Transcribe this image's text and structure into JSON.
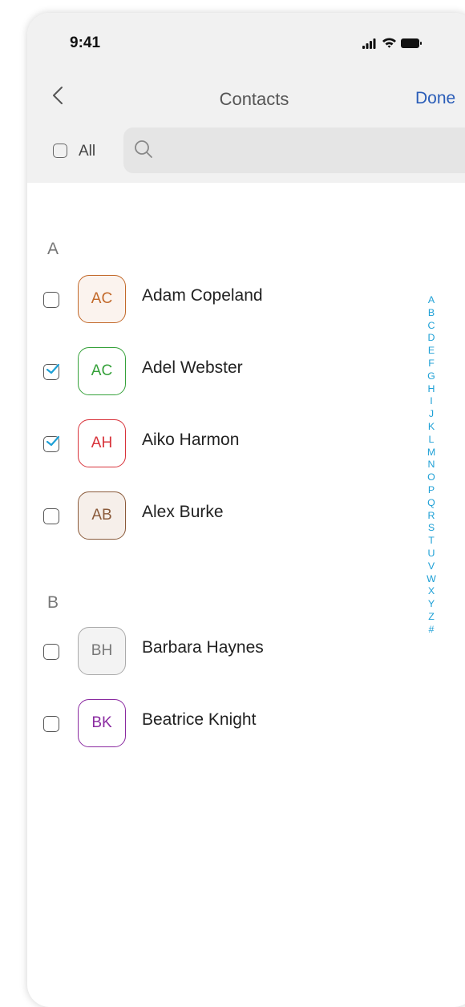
{
  "status_bar": {
    "time": "9:41"
  },
  "nav": {
    "title": "Contacts",
    "done_label": "Done"
  },
  "toolbar": {
    "all_label": "All",
    "all_checked": false,
    "search_placeholder": "",
    "search_value": ""
  },
  "colors": {
    "accent": "#1ea0d6",
    "done": "#2a5db8",
    "header_bg": "#f1f1f1"
  },
  "sections": [
    {
      "header": "A",
      "contacts": [
        {
          "initials": "AC",
          "name": "Adam Copeland",
          "checked": false,
          "color": "#c2692a",
          "bg": "#fbf3ee"
        },
        {
          "initials": "AC",
          "name": "Adel Webster",
          "checked": true,
          "color": "#35a13a",
          "bg": "#ffffff"
        },
        {
          "initials": "AH",
          "name": "Aiko Harmon",
          "checked": true,
          "color": "#d8323a",
          "bg": "#ffffff"
        },
        {
          "initials": "AB",
          "name": "Alex Burke",
          "checked": false,
          "color": "#8a5a3a",
          "bg": "#f6efea"
        }
      ]
    },
    {
      "header": "B",
      "contacts": [
        {
          "initials": "BH",
          "name": "Barbara Haynes",
          "checked": false,
          "color": "#777777",
          "bg": "#f3f3f3"
        },
        {
          "initials": "BK",
          "name": "Beatrice Knight",
          "checked": false,
          "color": "#8a2aa0",
          "bg": "#ffffff"
        }
      ]
    }
  ],
  "alphabet_index": [
    "A",
    "B",
    "C",
    "D",
    "E",
    "F",
    "G",
    "H",
    "I",
    "J",
    "K",
    "L",
    "M",
    "N",
    "O",
    "P",
    "Q",
    "R",
    "S",
    "T",
    "U",
    "V",
    "W",
    "X",
    "Y",
    "Z",
    "#"
  ]
}
